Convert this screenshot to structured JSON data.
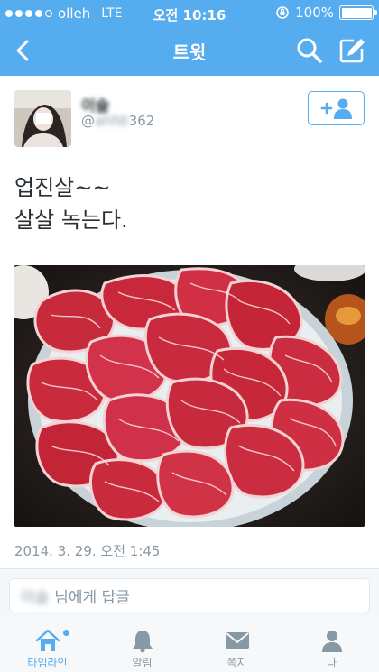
{
  "status_bar": {
    "carrier": "olleh",
    "network": "LTE",
    "time": "오전 10:16",
    "battery": "100%"
  },
  "nav": {
    "title": "트윗",
    "back_icon": "chevron-left-icon",
    "search_icon": "search-icon",
    "compose_icon": "compose-icon"
  },
  "tweet": {
    "display_name": "이슬",
    "username_prefix": "@",
    "username_masked": "ahfdi",
    "username_suffix": "362",
    "text_lines": [
      "업진살~~",
      "살살 녹는다."
    ],
    "photo_icon": "photo-image",
    "timestamp": "2014. 3. 29. 오전 1:45",
    "follow_icon": "add-user-icon"
  },
  "reply": {
    "placeholder_masked": "이슬",
    "placeholder": "님에게 답글"
  },
  "tabs": [
    {
      "label": "타임라인",
      "icon": "home-icon",
      "active": true
    },
    {
      "label": "알림",
      "icon": "bell-icon",
      "active": false
    },
    {
      "label": "쪽지",
      "icon": "envelope-icon",
      "active": false
    },
    {
      "label": "나",
      "icon": "person-icon",
      "active": false
    }
  ],
  "colors": {
    "brand": "#55acee",
    "text": "#292f33",
    "muted": "#8899a6"
  }
}
